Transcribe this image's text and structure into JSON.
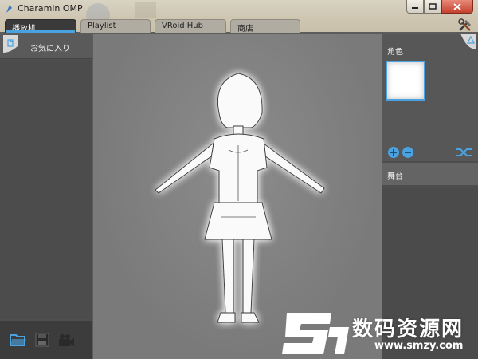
{
  "window": {
    "title": "Charamin OMP"
  },
  "tabs": [
    {
      "label": "播放机",
      "active": true
    },
    {
      "label": "Playlist",
      "active": false
    },
    {
      "label": "VRoid Hub",
      "active": false
    },
    {
      "label": "商店",
      "active": false
    }
  ],
  "left_panel": {
    "favorites_label": "お気に入り"
  },
  "right_panel": {
    "role_label": "角色",
    "stage_label": "舞台"
  },
  "watermark": {
    "text": "数码资源网",
    "url": "www.smzy.com"
  },
  "colors": {
    "accent": "#4aa3e0",
    "panel": "#4f4f4f",
    "viewport": "#808080"
  }
}
